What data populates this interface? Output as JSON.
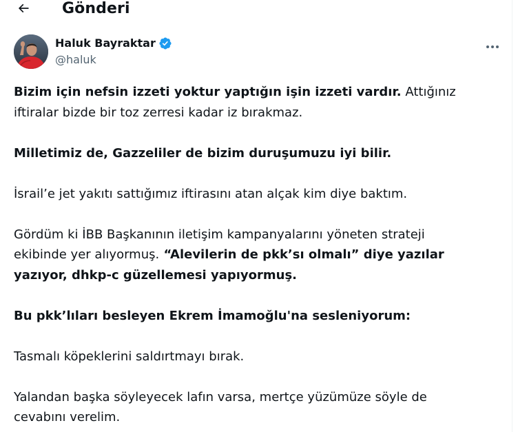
{
  "header": {
    "back_icon": "arrow-left-icon",
    "title": "Gönderi"
  },
  "author": {
    "display_name": "Haluk Bayraktar",
    "verified_icon": "verified-badge-icon",
    "verified_color": "#1d9bf0",
    "handle": "@haluk",
    "more_icon": "more-horizontal-icon"
  },
  "tweet": {
    "p1_bold": "Bizim için nefsin izzeti yoktur yaptığın işin izzeti vardır.",
    "p1_rest_line1": " Attığınız",
    "p1_line2": "iftiralar bizde bir toz zerresi kadar iz bırakmaz.",
    "p2_bold": "Milletimiz de, Gazzeliler de bizim duruşumuzu iyi bilir.",
    "p3": "İsrail’e jet yakıtı sattığımız iftirasını atan alçak kim diye baktım.",
    "p4_line1": "Gördüm ki İBB Başkanının iletişim kampanyalarını yöneten strateji",
    "p4_line2_plain": "ekibinde yer alıyormuş.",
    "p4_line2_bold": " “Alevilerin de pkk’sı olmalı” diye yazılar",
    "p4_line3_bold": "yazıyor, dhkp-c güzellemesi yapıyormuş.",
    "p5_bold": "Bu pkk’lıları besleyen Ekrem İmamoğlu'na sesleniyorum:",
    "p6": "Tasmalı köpeklerini saldırtmayı bırak.",
    "p7_line1": "Yalandan başka söyleyecek lafın varsa, mertçe yüzümüze söyle de",
    "p7_line2": "cevabını verelim."
  }
}
